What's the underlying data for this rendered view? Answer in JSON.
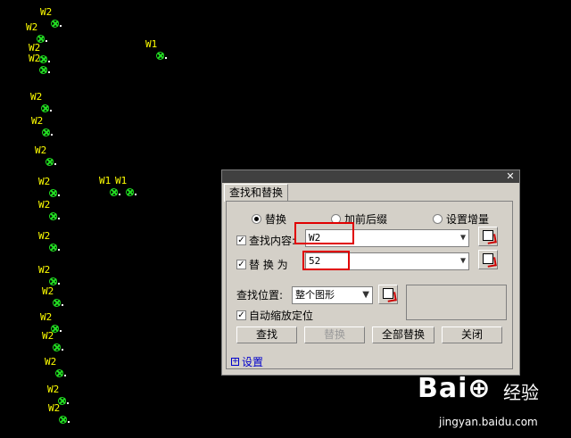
{
  "drawing": {
    "markers": [
      {
        "label": "W2"
      },
      {
        "label": "W2"
      },
      {
        "label": "W2"
      },
      {
        "label": "W2"
      },
      {
        "label": "W1"
      },
      {
        "label": "W2"
      },
      {
        "label": "W2"
      },
      {
        "label": "W2"
      },
      {
        "label": "W2"
      },
      {
        "label": "W1"
      },
      {
        "label": "W1"
      },
      {
        "label": "W2"
      },
      {
        "label": "W2"
      },
      {
        "label": "W2"
      },
      {
        "label": "W2"
      },
      {
        "label": "W2"
      },
      {
        "label": "W2"
      },
      {
        "label": "W2"
      },
      {
        "label": "W2"
      },
      {
        "label": "W2"
      }
    ]
  },
  "dialog": {
    "tab_title": "查找和替换",
    "close": "✕",
    "modes": [
      "替换",
      "加前后缀",
      "设置增量"
    ],
    "selected_mode": "替换",
    "find_label": "查找内容:",
    "find_value": "W2",
    "replace_label": "替 换 为",
    "replace_value": "52",
    "scope_label": "查找位置:",
    "scope_value": "整个图形",
    "auto_zoom_label": "自动缩放定位",
    "buttons": {
      "find": "查找",
      "replace": "替换",
      "replace_all": "全部替换",
      "close": "关闭"
    },
    "settings_label": "设置",
    "settings_icon": "+"
  },
  "watermark": {
    "logo": "Bai⊕",
    "cn": "经验",
    "url": "jingyan.baidu.com"
  }
}
